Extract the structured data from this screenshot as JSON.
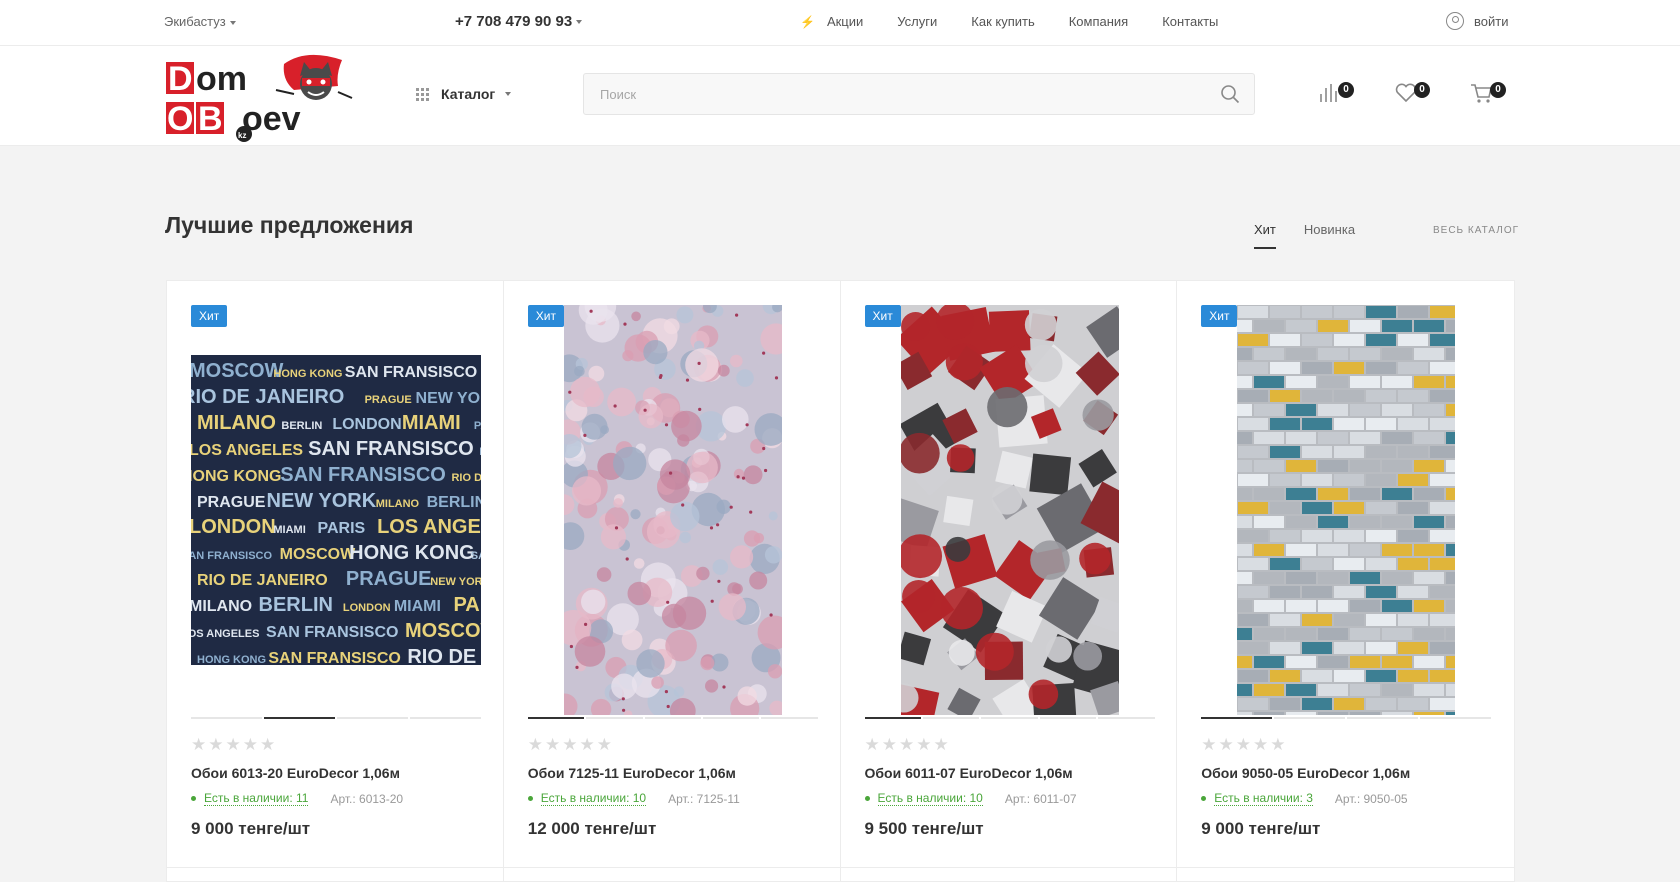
{
  "topbar": {
    "city": "Экибастуз",
    "phone": "+7 708 479 90 93",
    "nav": [
      "Акции",
      "Услуги",
      "Как купить",
      "Компания",
      "Контакты"
    ],
    "login": "войти"
  },
  "header": {
    "logo_text": [
      "Dom",
      "OBoev",
      "kz"
    ],
    "catalog": "Каталог",
    "search_placeholder": "Поиск",
    "compare_count": "0",
    "favorites_count": "0",
    "cart_count": "0"
  },
  "section": {
    "title": "Лучшие предложения",
    "tabs": [
      "Хит",
      "Новинка"
    ],
    "active_tab": "Хит",
    "all_catalog": "весь каталог"
  },
  "products": [
    {
      "badge": "Хит",
      "name": "Обои 6013-20 EuroDecor 1,06м",
      "stock": "Есть в наличии: 11",
      "article": "Арт.: 6013-20",
      "price": "9 000 тенге/шт",
      "rating": 0,
      "image_icon": "city-names-wallpaper"
    },
    {
      "badge": "Хит",
      "name": "Обои 7125-11 EuroDecor 1,06м",
      "stock": "Есть в наличии: 10",
      "article": "Арт.: 7125-11",
      "price": "12 000 тенге/шт",
      "rating": 0,
      "image_icon": "floral-wallpaper"
    },
    {
      "badge": "Хит",
      "name": "Обои 6011-07 EuroDecor 1,06м",
      "stock": "Есть в наличии: 10",
      "article": "Арт.: 6011-07",
      "price": "9 500 тенге/шт",
      "rating": 0,
      "image_icon": "geometric-wallpaper"
    },
    {
      "badge": "Хит",
      "name": "Обои 9050-05 EuroDecor 1,06м",
      "stock": "Есть в наличии: 3",
      "article": "Арт.: 9050-05",
      "price": "9 000 тенге/шт",
      "rating": 0,
      "image_icon": "brick-pattern-wallpaper"
    }
  ],
  "city_words": [
    "MOSCOW",
    "HONG KONG",
    "SAN FRANSISCO",
    "RIO DE JANEIRO",
    "PRAGUE",
    "NEW YORK",
    "MILANO",
    "BERLIN",
    "LONDON",
    "MIAMI",
    "PARIS",
    "LOS ANGELES",
    "SAN FRANSISCO"
  ],
  "colors": {
    "badge": "#2a8ad8",
    "stock": "#4aa63a",
    "logo_red": "#d8202a",
    "text": "#333333"
  }
}
